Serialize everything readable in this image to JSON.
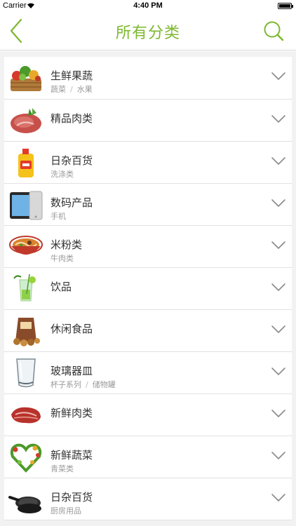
{
  "status": {
    "carrier": "Carrier",
    "time": "4:40 PM"
  },
  "nav": {
    "title": "所有分类"
  },
  "colors": {
    "accent": "#7cb82f",
    "text": "#333333",
    "subtext": "#9a9a9a"
  },
  "categories": [
    {
      "title": "生鲜果蔬",
      "subs": [
        "蔬菜",
        "水果"
      ],
      "icon": "vegetable-basket-icon"
    },
    {
      "title": "精品肉类",
      "subs": [],
      "icon": "meat-icon"
    },
    {
      "title": "日杂百货",
      "subs": [
        "洗涤类"
      ],
      "icon": "detergent-bottle-icon"
    },
    {
      "title": "数码产品",
      "subs": [
        "手机"
      ],
      "icon": "tablet-icon"
    },
    {
      "title": "米粉类",
      "subs": [
        "牛肉类"
      ],
      "icon": "noodle-bowl-icon"
    },
    {
      "title": "饮品",
      "subs": [],
      "icon": "drink-glass-icon"
    },
    {
      "title": "休闲食品",
      "subs": [],
      "icon": "snack-bag-icon"
    },
    {
      "title": "玻璃器皿",
      "subs": [
        "杯子系列",
        "储物罐"
      ],
      "icon": "glass-cup-icon"
    },
    {
      "title": "新鲜肉类",
      "subs": [],
      "icon": "steak-icon"
    },
    {
      "title": "新鲜蔬菜",
      "subs": [
        "青菜类"
      ],
      "icon": "vegetable-heart-icon"
    },
    {
      "title": "日杂百货",
      "subs": [
        "厨房用品"
      ],
      "icon": "frying-pan-icon"
    }
  ]
}
